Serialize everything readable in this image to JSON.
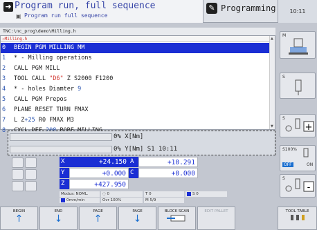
{
  "header": {
    "title": "Program run, full sequence",
    "subtitle": "Program run full sequence",
    "mode": "Programming",
    "clock": "10:11"
  },
  "path": "TNC:\\nc_prog\\demo\\Milling.h",
  "program": {
    "filename": "→Milling.h",
    "lines": [
      {
        "n": "0",
        "text": "BEGIN PGM MILLING MM"
      },
      {
        "n": "1",
        "text": "* - Milling operations"
      },
      {
        "n": "2",
        "text": "CALL PGM MILL"
      },
      {
        "n": "3",
        "text": "TOOL CALL \"D6\" Z S2000 F1200"
      },
      {
        "n": "4",
        "text": "* - holes Diamter 9"
      },
      {
        "n": "5",
        "text": "CALL PGM Prepos"
      },
      {
        "n": "6",
        "text": "PLANE RESET TURN FMAX"
      },
      {
        "n": "7",
        "text": "L  Z+25 R0 FMAX M3"
      },
      {
        "n": "8",
        "text": "CYCL DEF 208 BORE MILLING"
      }
    ]
  },
  "status": {
    "line1": "0% X[Nm]",
    "line2": "0% Y[Nm] S1  10:11"
  },
  "position": {
    "x_label": "X",
    "x_value": "+24.150",
    "y_label": "Y",
    "y_value": "+0.000",
    "z_label": "Z",
    "z_value": "+427.950",
    "a_label": "A",
    "a_value": "+10.291",
    "c_label": "C",
    "c_value": "+0.000",
    "mode": "Modus: NOML.",
    "t": "T 0",
    "s": "S 0",
    "feed": "0mm/min",
    "ovr": "Ovr 100%",
    "m": "M 5/9"
  },
  "right": {
    "m": "M",
    "s": "S",
    "s100": "S100%",
    "off": "OFF",
    "on": "ON"
  },
  "softkeys": [
    {
      "label": "BEGIN",
      "arrow": "↑"
    },
    {
      "label": "END",
      "arrow": "↓"
    },
    {
      "label": "PAGE",
      "arrow": "↑"
    },
    {
      "label": "PAGE",
      "arrow": "↓"
    },
    {
      "label": "BLOCK SCAN"
    },
    {
      "label": "EDIT PALLET"
    },
    {
      "label": "TOOL TABLE"
    }
  ]
}
